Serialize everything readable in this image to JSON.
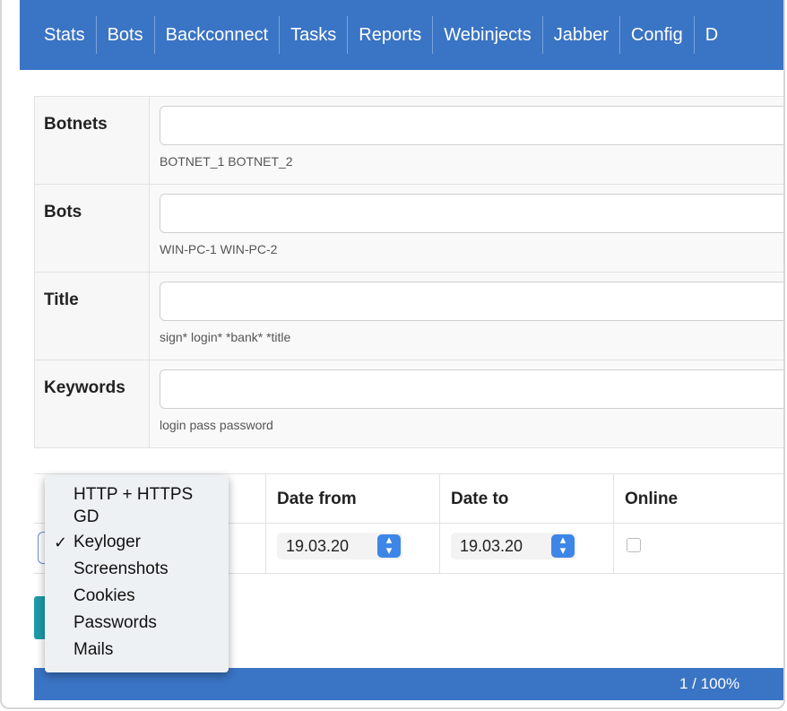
{
  "nav": {
    "items": [
      "Stats",
      "Bots",
      "Backconnect",
      "Tasks",
      "Reports",
      "Webinjects",
      "Jabber",
      "Config",
      "D"
    ]
  },
  "filters": [
    {
      "label": "Botnets",
      "hint": "BOTNET_1 BOTNET_2",
      "value": ""
    },
    {
      "label": "Bots",
      "hint": "WIN-PC-1 WIN-PC-2",
      "value": ""
    },
    {
      "label": "Title",
      "hint": "sign* login* *bank* *title",
      "value": ""
    },
    {
      "label": "Keywords",
      "hint": "login pass password",
      "value": ""
    }
  ],
  "lower": {
    "date_from_label": "Date from",
    "date_to_label": "Date to",
    "online_label": "Online",
    "date_from_value": "19.03.20",
    "date_to_value": "19.03.20",
    "online_checked": false
  },
  "dropdown": {
    "options": [
      "HTTP + HTTPS",
      "GD",
      "Keyloger",
      "Screenshots",
      "Cookies",
      "Passwords",
      "Mails"
    ],
    "selected": "Keyloger",
    "check_glyph": "✓"
  },
  "progress": {
    "text": "1 / 100%",
    "fraction": 0.01
  },
  "colors": {
    "nav_bg": "#3a74c4",
    "accent_teal": "#1f9aa8",
    "spinner_blue": "#3d86e8"
  }
}
